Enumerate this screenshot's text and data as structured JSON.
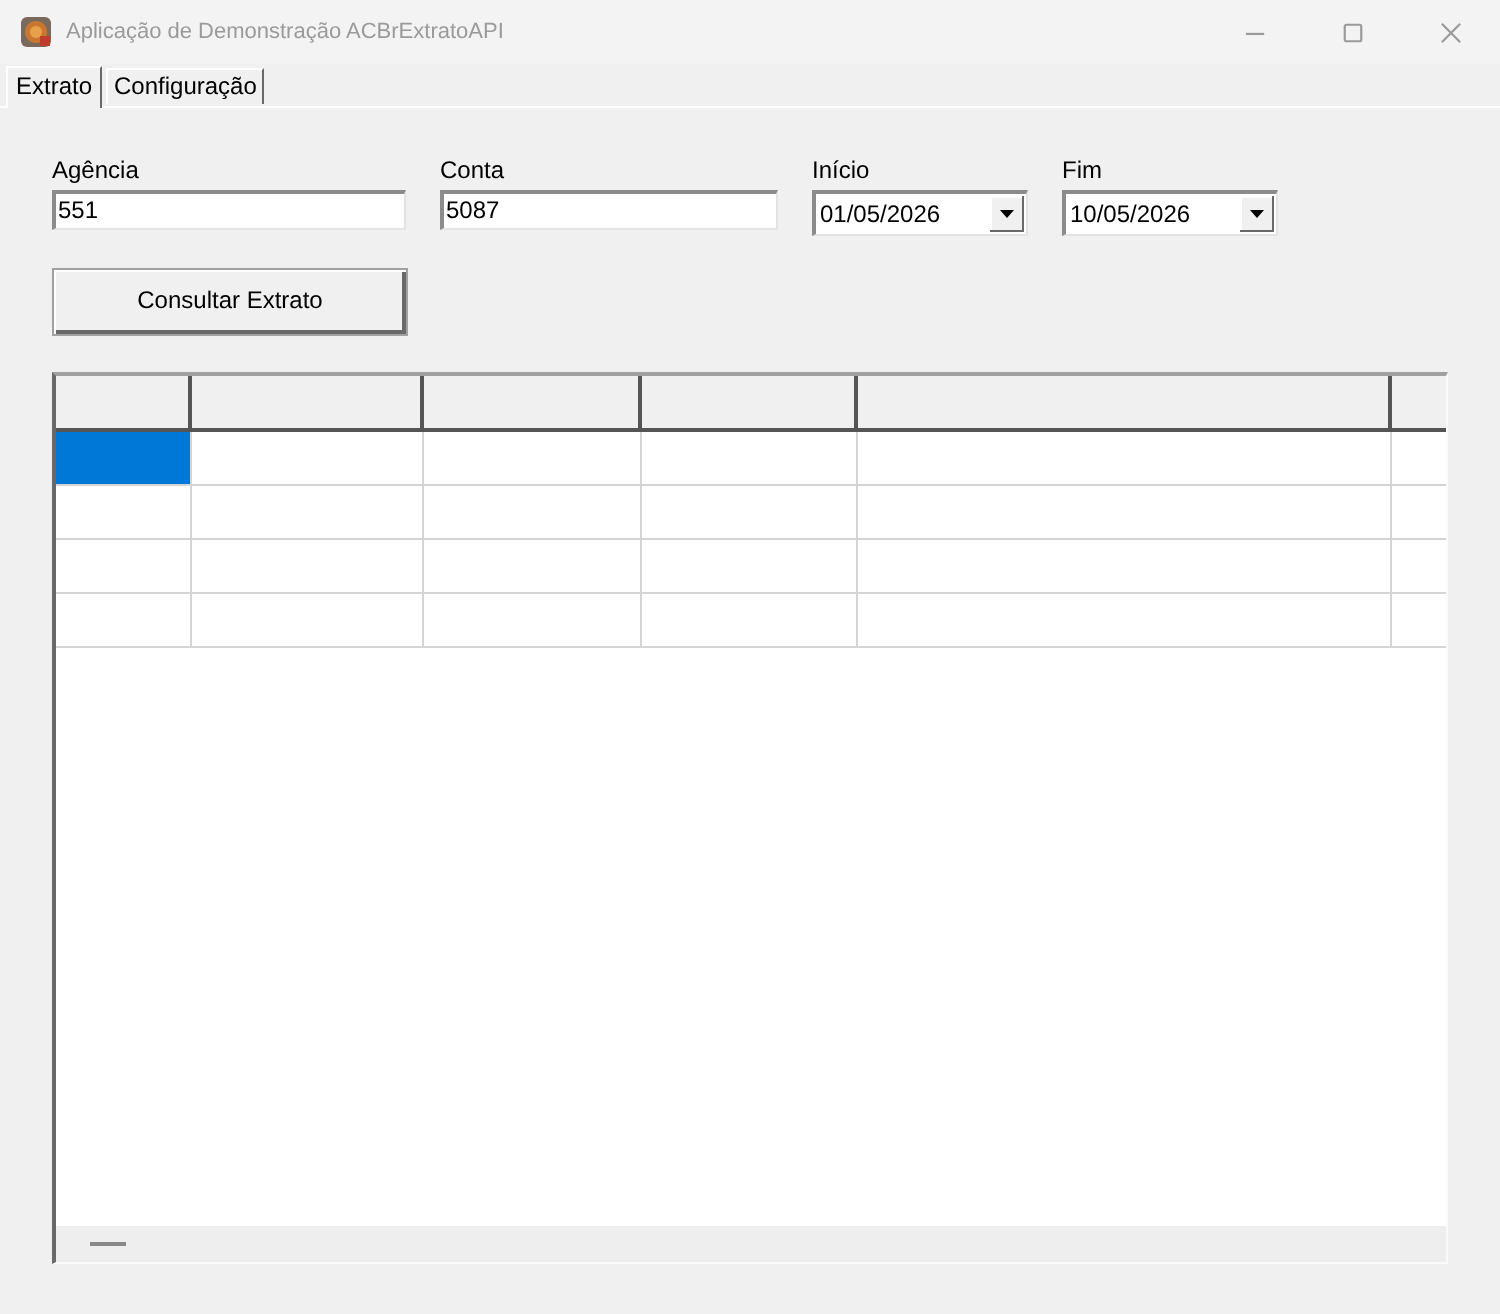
{
  "window": {
    "title": "Aplicação de Demonstração ACBrExtratoAPI"
  },
  "tabs": [
    {
      "label": "Extrato",
      "selected": true
    },
    {
      "label": "Configuração",
      "selected": false
    }
  ],
  "form": {
    "fields": [
      {
        "kind": "text",
        "label": "Agência",
        "value": "551"
      },
      {
        "kind": "text",
        "label": "Conta",
        "value": "5087"
      },
      {
        "kind": "date",
        "label": "Início",
        "value": "01/05/2026"
      },
      {
        "kind": "date",
        "label": "Fim",
        "value": "10/05/2026"
      }
    ],
    "button": "Consultar Extrato"
  },
  "grid": {
    "rows": [
      {
        "cells": [
          {
            "selected": true
          },
          {
            "selected": false
          },
          {
            "selected": false
          },
          {
            "selected": false
          },
          {
            "selected": false
          },
          {
            "selected": false
          }
        ]
      },
      {
        "cells": [
          {
            "selected": false
          },
          {
            "selected": false
          },
          {
            "selected": false
          },
          {
            "selected": false
          },
          {
            "selected": false
          },
          {
            "selected": false
          }
        ]
      },
      {
        "cells": [
          {
            "selected": false
          },
          {
            "selected": false
          },
          {
            "selected": false
          },
          {
            "selected": false
          },
          {
            "selected": false
          },
          {
            "selected": false
          }
        ]
      },
      {
        "cells": [
          {
            "selected": false
          },
          {
            "selected": false
          },
          {
            "selected": false
          },
          {
            "selected": false
          },
          {
            "selected": false
          },
          {
            "selected": false
          }
        ]
      }
    ]
  }
}
